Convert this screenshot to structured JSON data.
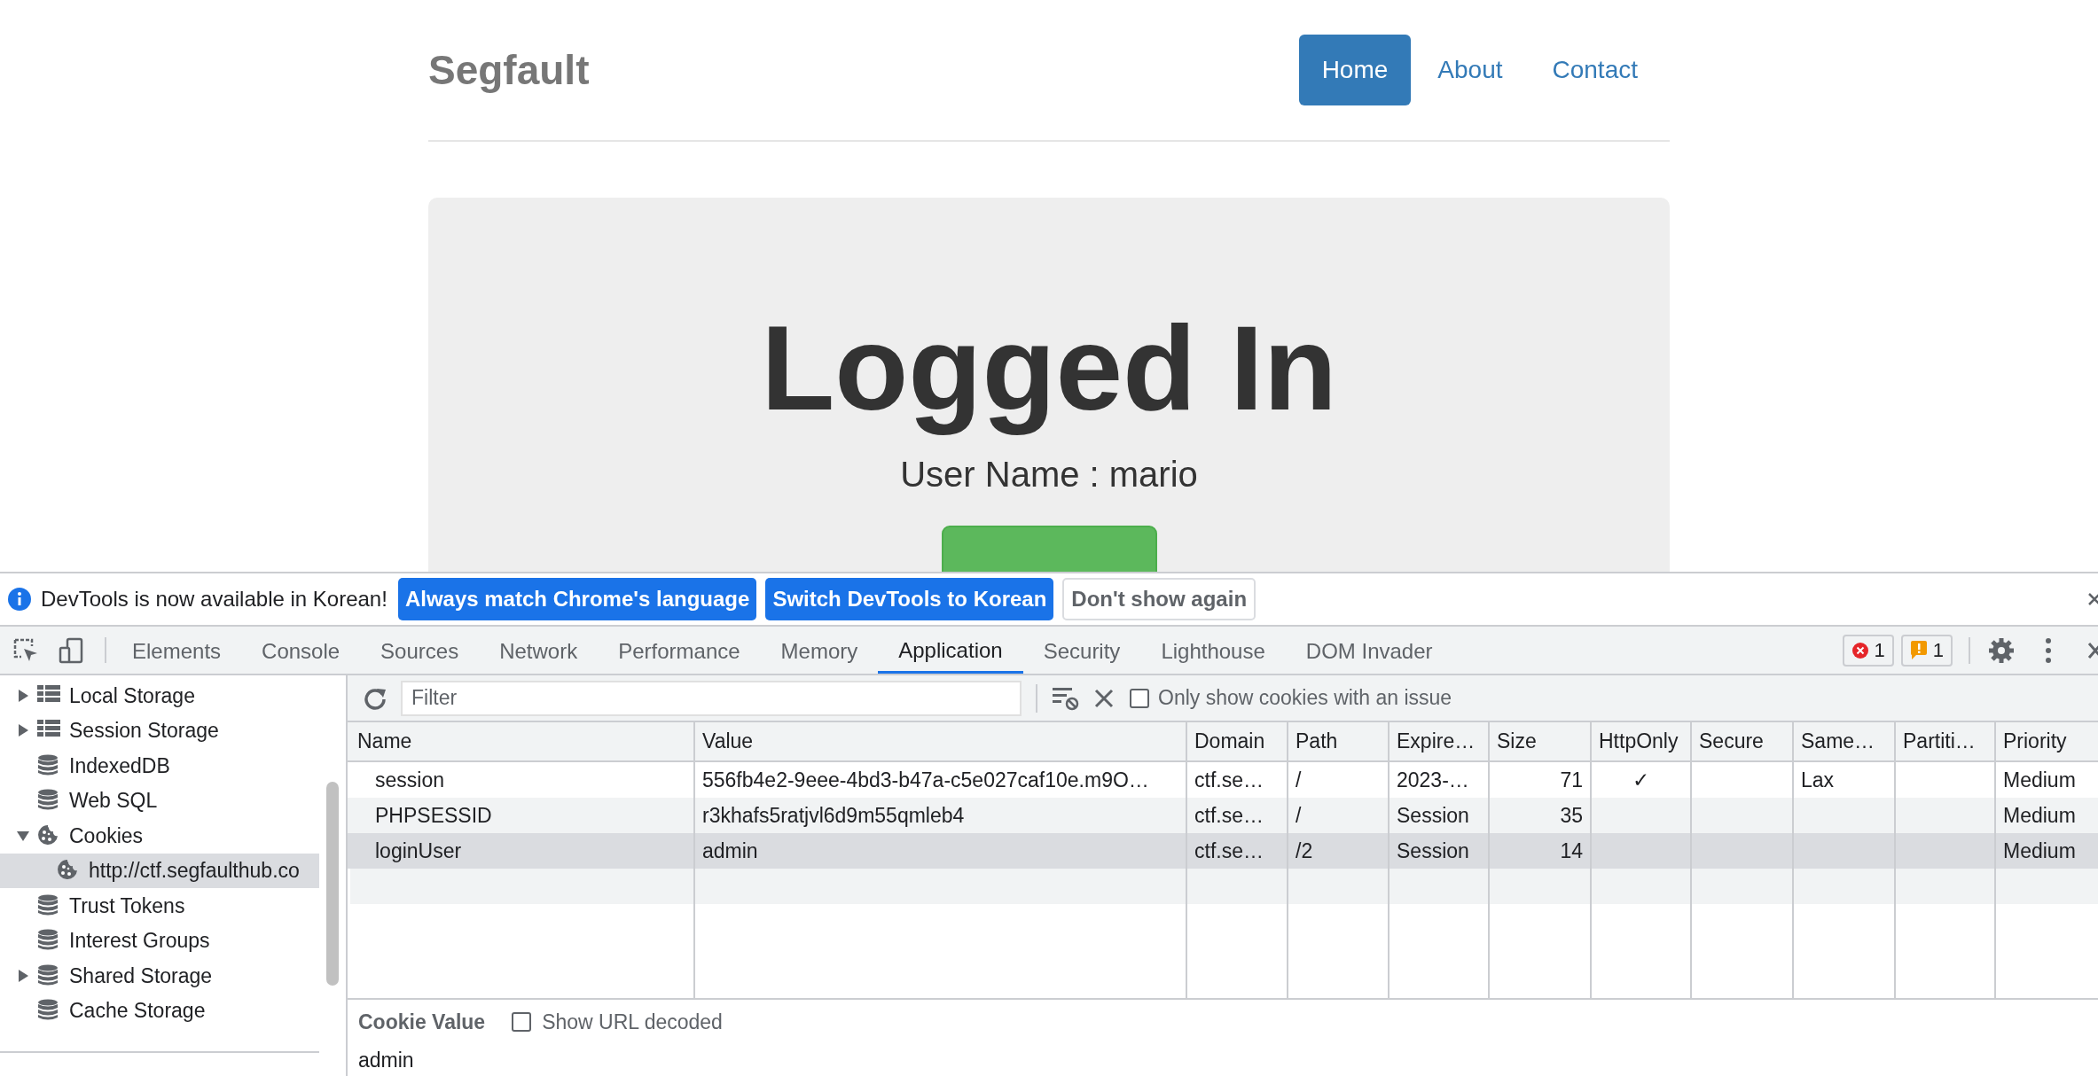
{
  "page": {
    "brand": "Segfault",
    "nav": [
      {
        "label": "Home",
        "selected": true
      },
      {
        "label": "About",
        "selected": false
      },
      {
        "label": "Contact",
        "selected": false
      }
    ],
    "heading": "Logged In",
    "subtitle": "User Name : mario"
  },
  "devtools": {
    "infobar": {
      "message": "DevTools is now available in Korean!",
      "buttons": [
        {
          "label": "Always match Chrome's language",
          "kind": "primary"
        },
        {
          "label": "Switch DevTools to Korean",
          "kind": "primary"
        },
        {
          "label": "Don't show again",
          "kind": "secondary"
        }
      ]
    },
    "tabs": [
      {
        "label": "Elements",
        "selected": false
      },
      {
        "label": "Console",
        "selected": false
      },
      {
        "label": "Sources",
        "selected": false
      },
      {
        "label": "Network",
        "selected": false
      },
      {
        "label": "Performance",
        "selected": false
      },
      {
        "label": "Memory",
        "selected": false
      },
      {
        "label": "Application",
        "selected": true
      },
      {
        "label": "Security",
        "selected": false
      },
      {
        "label": "Lighthouse",
        "selected": false
      },
      {
        "label": "DOM Invader",
        "selected": false
      }
    ],
    "error_count": "1",
    "warning_count": "1",
    "sidebar": [
      {
        "label": "Local Storage",
        "kind": "grid",
        "expanded": false,
        "selected": false
      },
      {
        "label": "Session Storage",
        "kind": "grid",
        "expanded": false,
        "selected": false
      },
      {
        "label": "IndexedDB",
        "kind": "database",
        "selected": false
      },
      {
        "label": "Web SQL",
        "kind": "database",
        "selected": false
      },
      {
        "label": "Cookies",
        "kind": "cookie",
        "expanded": true,
        "selected": false,
        "children": [
          {
            "label": "http://ctf.segfaulthub.co",
            "kind": "cookie",
            "selected": true
          }
        ]
      },
      {
        "label": "Trust Tokens",
        "kind": "database",
        "selected": false
      },
      {
        "label": "Interest Groups",
        "kind": "database",
        "selected": false
      },
      {
        "label": "Shared Storage",
        "kind": "database",
        "expanded": false,
        "selected": false
      },
      {
        "label": "Cache Storage",
        "kind": "database",
        "selected": false
      }
    ],
    "filter": {
      "placeholder": "Filter"
    },
    "issue_filter": {
      "label": "Only show cookies with an issue",
      "checked": false
    },
    "table": {
      "columns": [
        {
          "label": "Name",
          "kind": "text"
        },
        {
          "label": "Value",
          "kind": "text"
        },
        {
          "label": "Domain",
          "kind": "text"
        },
        {
          "label": "Path",
          "kind": "text"
        },
        {
          "label": "Expire…",
          "kind": "text"
        },
        {
          "label": "Size",
          "kind": "number"
        },
        {
          "label": "HttpOnly",
          "kind": "flag"
        },
        {
          "label": "Secure",
          "kind": "flag"
        },
        {
          "label": "Same…",
          "kind": "text"
        },
        {
          "label": "Partiti…",
          "kind": "text"
        },
        {
          "label": "Priority",
          "kind": "text"
        }
      ],
      "rows": [
        {
          "selected": false,
          "cells": [
            "session",
            "556fb4e2-9eee-4bd3-b47a-c5e027caf10e.m9O…",
            "ctf.se…",
            "/",
            "2023-…",
            "71",
            "✓",
            "",
            "Lax",
            "",
            "Medium"
          ]
        },
        {
          "selected": false,
          "cells": [
            "PHPSESSID",
            "r3khafs5ratjvl6d9m55qmleb4",
            "ctf.se…",
            "/",
            "Session",
            "35",
            "",
            "",
            "",
            "",
            "Medium"
          ]
        },
        {
          "selected": true,
          "cells": [
            "loginUser",
            "admin",
            "ctf.se…",
            "/2",
            "Session",
            "14",
            "",
            "",
            "",
            "",
            "Medium"
          ]
        }
      ]
    },
    "cookie_value": {
      "label": "Cookie Value",
      "decode_label": "Show URL decoded",
      "decode_checked": false,
      "value": "admin"
    }
  }
}
